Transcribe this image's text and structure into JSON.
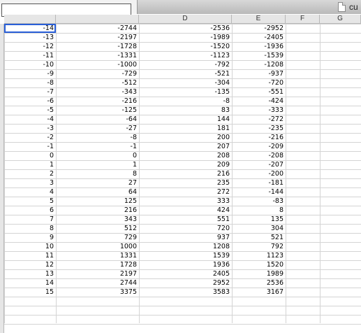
{
  "toolbar": {
    "name_box_value": "",
    "file_tab_label": "cu"
  },
  "columns": [
    "D",
    "E",
    "F",
    "G"
  ],
  "rows": [
    [
      "-14",
      "-2744",
      "-2536",
      "-2952"
    ],
    [
      "-13",
      "-2197",
      "-1989",
      "-2405"
    ],
    [
      "-12",
      "-1728",
      "-1520",
      "-1936"
    ],
    [
      "-11",
      "-1331",
      "-1123",
      "-1539"
    ],
    [
      "-10",
      "-1000",
      "-792",
      "-1208"
    ],
    [
      "-9",
      "-729",
      "-521",
      "-937"
    ],
    [
      "-8",
      "-512",
      "-304",
      "-720"
    ],
    [
      "-7",
      "-343",
      "-135",
      "-551"
    ],
    [
      "-6",
      "-216",
      "-8",
      "-424"
    ],
    [
      "-5",
      "-125",
      "83",
      "-333"
    ],
    [
      "-4",
      "-64",
      "144",
      "-272"
    ],
    [
      "-3",
      "-27",
      "181",
      "-235"
    ],
    [
      "-2",
      "-8",
      "200",
      "-216"
    ],
    [
      "-1",
      "-1",
      "207",
      "-209"
    ],
    [
      "0",
      "0",
      "208",
      "-208"
    ],
    [
      "1",
      "1",
      "209",
      "-207"
    ],
    [
      "2",
      "8",
      "216",
      "-200"
    ],
    [
      "3",
      "27",
      "235",
      "-181"
    ],
    [
      "4",
      "64",
      "272",
      "-144"
    ],
    [
      "5",
      "125",
      "333",
      "-83"
    ],
    [
      "6",
      "216",
      "424",
      "8"
    ],
    [
      "7",
      "343",
      "551",
      "135"
    ],
    [
      "8",
      "512",
      "720",
      "304"
    ],
    [
      "9",
      "729",
      "937",
      "521"
    ],
    [
      "10",
      "1000",
      "1208",
      "792"
    ],
    [
      "11",
      "1331",
      "1539",
      "1123"
    ],
    [
      "12",
      "1728",
      "1936",
      "1520"
    ],
    [
      "13",
      "2197",
      "2405",
      "1989"
    ],
    [
      "14",
      "2744",
      "2952",
      "2536"
    ],
    [
      "15",
      "3375",
      "3583",
      "3167"
    ]
  ]
}
